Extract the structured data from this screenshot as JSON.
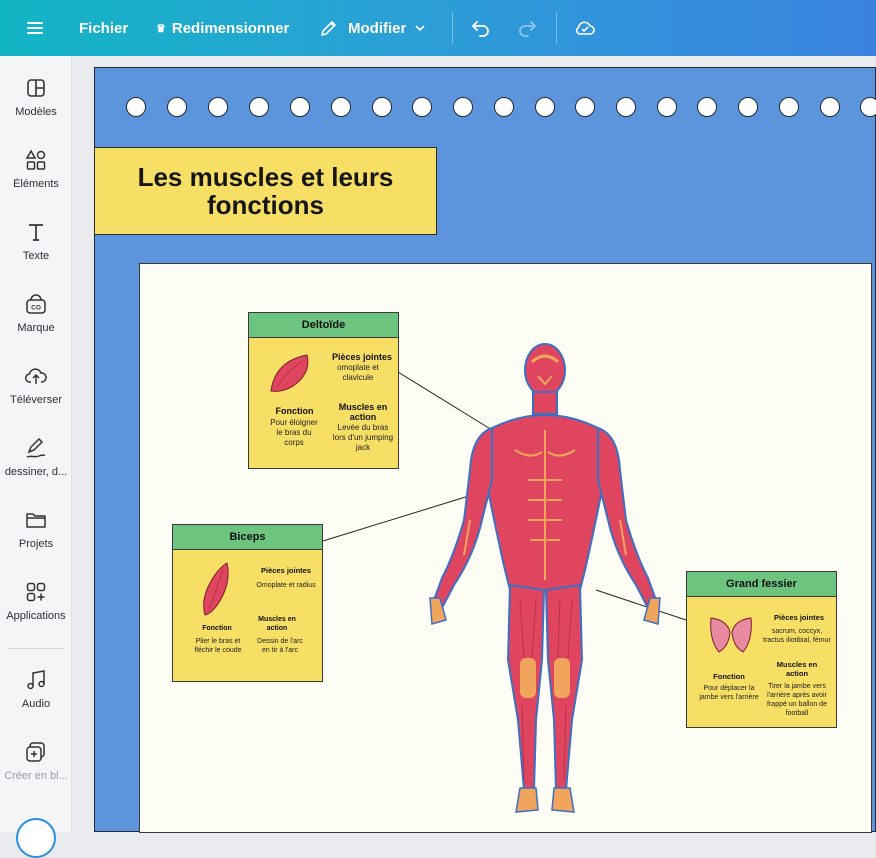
{
  "toolbar": {
    "menu_icon": "hamburger-icon",
    "file_label": "Fichier",
    "resize_label": "Redimensionner",
    "edit_label": "Modifier",
    "undo_icon": "undo-icon",
    "redo_icon": "redo-icon",
    "save_icon": "cloud-check-icon"
  },
  "sidebar": {
    "items": [
      {
        "label": "Modèles",
        "icon": "layout-icon"
      },
      {
        "label": "Éléments",
        "icon": "shapes-icon"
      },
      {
        "label": "Texte",
        "icon": "text-icon"
      },
      {
        "label": "Marque",
        "icon": "brand-icon"
      },
      {
        "label": "Téléverser",
        "icon": "upload-icon"
      },
      {
        "label": "dessiner, d...",
        "icon": "draw-icon"
      },
      {
        "label": "Projets",
        "icon": "folder-icon"
      },
      {
        "label": "Applications",
        "icon": "apps-icon"
      },
      {
        "label": "Audio",
        "icon": "music-icon"
      },
      {
        "label": "Créer en bl...",
        "icon": "bulk-create-icon"
      }
    ]
  },
  "document": {
    "title": "Les muscles et leurs fonctions",
    "cards": {
      "deltoid": {
        "name": "Deltoïde",
        "joints_title": "Pièces jointes",
        "joints_text": "omoplate et clavicule",
        "function_title": "Fonction",
        "function_text": "Pour éloigner le bras du corps",
        "action_title": "Muscles en action",
        "action_text": "Levée du bras lors d'un jumping jack"
      },
      "biceps": {
        "name": "Biceps",
        "joints_title": "Pièces jointes",
        "joints_text": "Omoplate et radius",
        "function_title": "Fonction",
        "function_text": "Plier le bras et fléchir le coude",
        "action_title": "Muscles en action",
        "action_text": "Dessin de l'arc en tir à l'arc"
      },
      "gluteus": {
        "name": "Grand fessier",
        "joints_title": "Pièces jointes",
        "joints_text": "sacrum, coccyx, tractus iliotibial, fémur",
        "function_title": "Fonction",
        "function_text": "Pour déplacer la jambe vers l'arrière",
        "action_title": "Muscles en action",
        "action_text": "Tirer la jambe vers l'arrière après avoir frappé un ballon de football"
      }
    }
  },
  "colors": {
    "topbar_start": "#12b5c4",
    "topbar_end": "#3b82e0",
    "page_background": "#5d95dc",
    "title_yellow": "#f7df66",
    "card_header_green": "#6cc47f",
    "muscle_red": "#e0455f",
    "tendon_orange": "#f0a45c"
  }
}
